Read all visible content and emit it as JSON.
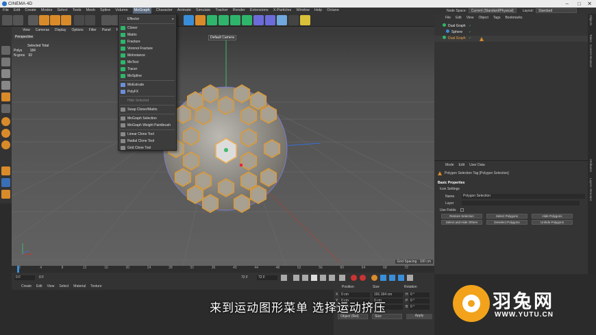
{
  "app": {
    "title": "CINEMA 4D"
  },
  "menubar": [
    "File",
    "Edit",
    "Create",
    "Modes",
    "Select",
    "Tools",
    "Mesh",
    "Spline",
    "Volume",
    "MoGraph",
    "Character",
    "Animate",
    "Simulate",
    "Tracker",
    "Render",
    "Extensions",
    "X-Particles",
    "Window",
    "Help",
    "Octane"
  ],
  "topright": {
    "node_space_label": "Node Space:",
    "node_space_value": "Current (Standard/Physical)",
    "layout_label": "Layout:",
    "layout_value": "Standard"
  },
  "viewport": {
    "menu": [
      "View",
      "Cameras",
      "Display",
      "Options",
      "Filter",
      "Panel",
      "ProRender"
    ],
    "view_name": "Perspective",
    "camera": "Default Camera",
    "stats": {
      "header": "Selected Total",
      "rows": [
        {
          "label": "Polys",
          "value": "184"
        },
        {
          "label": "N-gons",
          "value": "92"
        }
      ]
    },
    "grid_spacing": "Grid Spacing : 100 cm"
  },
  "mograph_menu": {
    "items": [
      {
        "label": "Effector",
        "type": "submenu"
      },
      {
        "label": "Cloner",
        "icon": "cloner-icon"
      },
      {
        "label": "Matrix",
        "icon": "matrix-icon"
      },
      {
        "label": "Fracture",
        "icon": "fracture-icon"
      },
      {
        "label": "Voronoi Fracture",
        "icon": "voronoi-icon"
      },
      {
        "label": "MoInstance",
        "icon": "moinstance-icon"
      },
      {
        "label": "MoText",
        "icon": "motext-icon"
      },
      {
        "label": "Tracer",
        "icon": "tracer-icon"
      },
      {
        "label": "MoSpline",
        "icon": "mospline-icon"
      },
      {
        "label": "MoExtrude",
        "icon": "moextrude-icon"
      },
      {
        "label": "PolyFX",
        "icon": "polyfx-icon"
      },
      {
        "label": "Hide Selected",
        "disabled": true
      },
      {
        "label": "Swap Cloner/Matrix",
        "icon": "swap-icon"
      },
      {
        "label": "MoGraph Selection",
        "icon": "selection-icon"
      },
      {
        "label": "MoGraph Weight Paintbrush",
        "icon": "paintbrush-icon"
      },
      {
        "label": "Linear Clone Tool",
        "icon": "linear-clone-icon"
      },
      {
        "label": "Radial Clone Tool",
        "icon": "radial-clone-icon"
      },
      {
        "label": "Grid Clone Tool",
        "icon": "grid-clone-icon"
      }
    ]
  },
  "timeline": {
    "ticks": [
      "0",
      "4",
      "8",
      "12",
      "16",
      "20",
      "24",
      "28",
      "32",
      "36",
      "40",
      "44",
      "48",
      "52",
      "56",
      "60",
      "64",
      "68",
      "72"
    ],
    "frame": "0 F"
  },
  "transport": {
    "start": "0 F",
    "current": "0 F",
    "end": "72 F",
    "max": "72 F"
  },
  "material": {
    "menu": [
      "Create",
      "Edit",
      "View",
      "Select",
      "Material",
      "Texture"
    ]
  },
  "coordinates": {
    "headers": [
      "Position",
      "Size",
      "Rotation"
    ],
    "rows": [
      {
        "axis": "X",
        "pos": "0 cm",
        "size": "191.164 cm",
        "rot_label": "H",
        "rot": "0 °"
      },
      {
        "axis": "Y",
        "pos": "0 cm",
        "size": "0 cm",
        "rot_label": "P",
        "rot": "0 °"
      },
      {
        "axis": "Z",
        "pos": "0 cm",
        "size": "0 cm",
        "rot_label": "B",
        "rot": "0 °"
      }
    ],
    "mode": "Object (Rel)",
    "size_mode": "Size",
    "apply": "Apply"
  },
  "object_manager": {
    "menu": [
      "File",
      "Edit",
      "View",
      "Object",
      "Tags",
      "Bookmarks"
    ],
    "objects": [
      {
        "name": "Dual Graph",
        "color": "#e8e8e8"
      },
      {
        "name": "Sphere",
        "color": "#e8e8e8"
      },
      {
        "name": "Dual Graph",
        "color": "#f0a040"
      }
    ]
  },
  "attributes": {
    "menu": [
      "Mode",
      "Edit",
      "User Data"
    ],
    "tag_title": "Polygon Selection Tag [Polygon Selection]",
    "section": "Basic Properties",
    "subsection": "Icon Settings",
    "fields": [
      {
        "label": "Name",
        "value": "Polygon Selection"
      },
      {
        "label": "Layer",
        "value": ""
      }
    ],
    "use_fields": "Use Fields",
    "buttons": [
      "Restore Selection",
      "Select Polygons",
      "Hide Polygons",
      "Select and Hide Others",
      "Deselect Polygons",
      "Unhide Polygons"
    ]
  },
  "right_tabs": [
    "Objects",
    "Takes",
    "Content Browser",
    "Attributes",
    "Layers",
    "Structure"
  ],
  "overlay": {
    "subtitle": "来到运动图形菜单 选择运动挤压",
    "brand": "羽兔网",
    "url": "WWW.YUTU.CN"
  }
}
